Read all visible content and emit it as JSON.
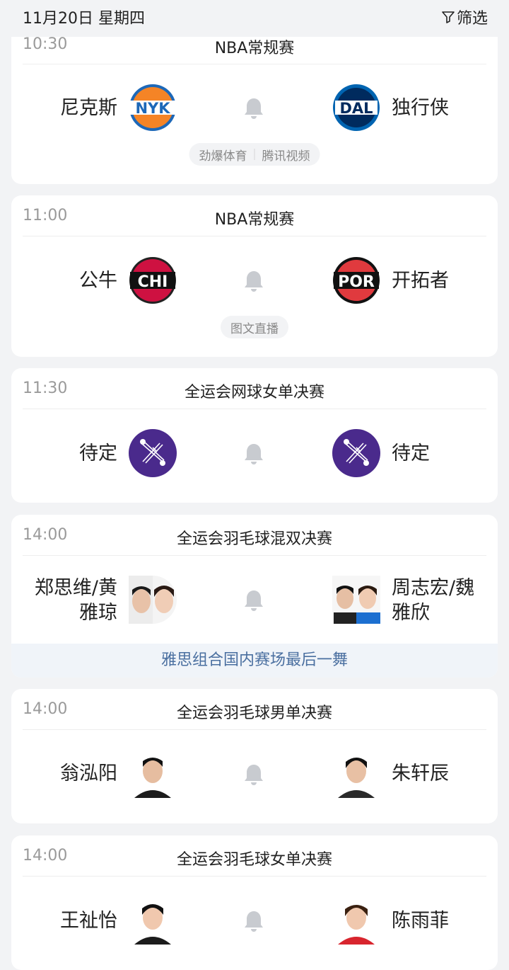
{
  "header": {
    "date": "11月20日 星期四",
    "filter_label": "筛选"
  },
  "matches": [
    {
      "time": "10:30",
      "league": "NBA常规赛",
      "home": {
        "name": "尼克斯",
        "logo_text": "NYK",
        "logo_icon": "knicks-logo"
      },
      "away": {
        "name": "独行侠",
        "logo_text": "DAL",
        "logo_icon": "mavericks-logo"
      },
      "channels": [
        "劲爆体育",
        "腾讯视频"
      ]
    },
    {
      "time": "11:00",
      "league": "NBA常规赛",
      "home": {
        "name": "公牛",
        "logo_text": "CHI",
        "logo_icon": "bulls-logo"
      },
      "away": {
        "name": "开拓者",
        "logo_text": "POR",
        "logo_icon": "blazers-logo"
      },
      "channels": [
        "图文直播"
      ]
    },
    {
      "time": "11:30",
      "league": "全运会网球女单决赛",
      "home": {
        "name": "待定",
        "logo_icon": "tennis-event-icon"
      },
      "away": {
        "name": "待定",
        "logo_icon": "tennis-event-icon"
      }
    },
    {
      "time": "14:00",
      "league": "全运会羽毛球混双决赛",
      "home": {
        "name_line1": "郑思维/黄",
        "name_line2": "雅琼",
        "logo_icon": "player-pair-photo"
      },
      "away": {
        "name_line1": "周志宏/魏",
        "name_line2": "雅欣",
        "logo_icon": "player-pair-photo"
      },
      "news": "雅思组合国内赛场最后一舞"
    },
    {
      "time": "14:00",
      "league": "全运会羽毛球男单决赛",
      "home": {
        "name": "翁泓阳",
        "logo_icon": "player-photo"
      },
      "away": {
        "name": "朱轩辰",
        "logo_icon": "player-photo"
      }
    },
    {
      "time": "14:00",
      "league": "全运会羽毛球女单决赛",
      "home": {
        "name": "王祉怡",
        "logo_icon": "player-photo"
      },
      "away": {
        "name": "陈雨菲",
        "logo_icon": "player-photo"
      }
    }
  ],
  "colors": {
    "knicks_orange": "#f58426",
    "knicks_blue": "#1d68b8",
    "mavs_blue": "#0064b1",
    "mavs_navy": "#002b5e",
    "bulls_red": "#ce1141",
    "blazers_red": "#e03a3e",
    "tennis_purple": "#4a2a8c",
    "bell_gray": "#c8cbd0"
  }
}
